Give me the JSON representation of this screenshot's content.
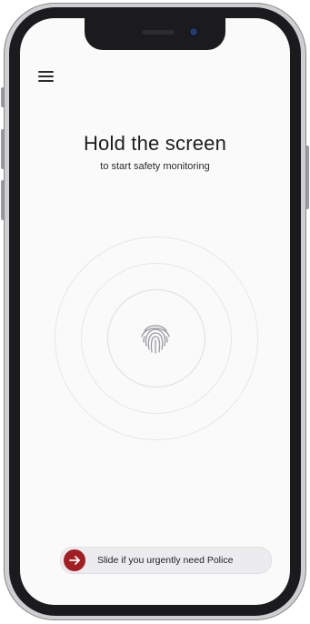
{
  "header": {
    "menu_icon": "hamburger-menu-icon"
  },
  "main": {
    "title": "Hold the screen",
    "subtitle": "to start safety monitoring",
    "hold_target_icon": "fingerprint-icon"
  },
  "emergency_slider": {
    "label": "Slide if you urgently need Police",
    "knob_icon": "arrow-right-icon",
    "accent_color": "#a31e22"
  },
  "colors": {
    "screen_background": "#fafafb",
    "text": "#1d1d20"
  }
}
